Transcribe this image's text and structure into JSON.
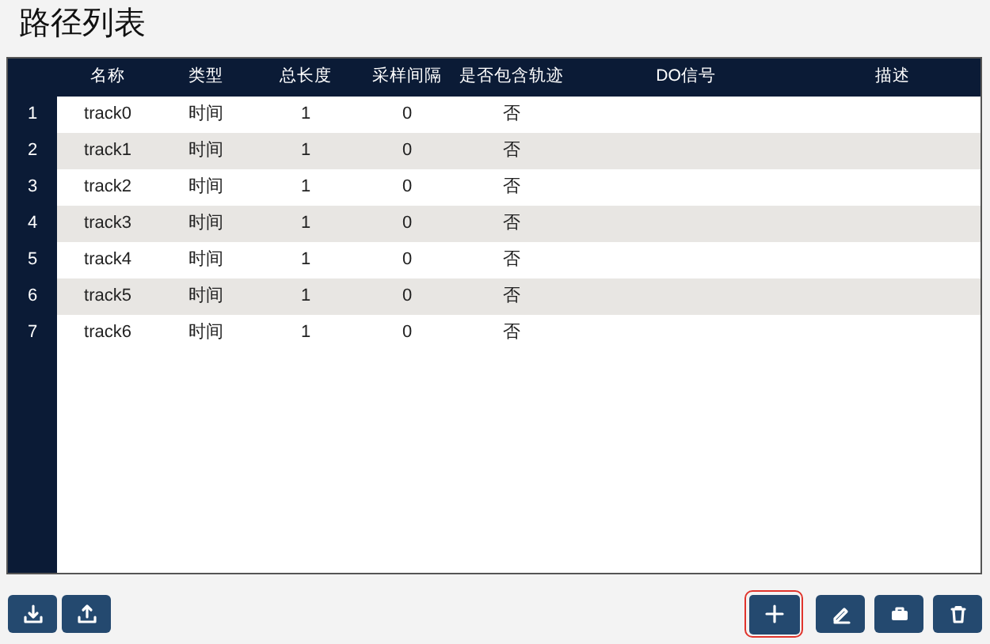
{
  "title": "路径列表",
  "table": {
    "columns": [
      "名称",
      "类型",
      "总长度",
      "采样间隔",
      "是否包含轨迹",
      "DO信号",
      "描述"
    ],
    "rows": [
      {
        "index": "1",
        "cells": [
          "track0",
          "时间",
          "1",
          "0",
          "否"
        ]
      },
      {
        "index": "2",
        "cells": [
          "track1",
          "时间",
          "1",
          "0",
          "否"
        ]
      },
      {
        "index": "3",
        "cells": [
          "track2",
          "时间",
          "1",
          "0",
          "否"
        ]
      },
      {
        "index": "4",
        "cells": [
          "track3",
          "时间",
          "1",
          "0",
          "否"
        ]
      },
      {
        "index": "5",
        "cells": [
          "track4",
          "时间",
          "1",
          "0",
          "否"
        ]
      },
      {
        "index": "6",
        "cells": [
          "track5",
          "时间",
          "1",
          "0",
          "否"
        ]
      },
      {
        "index": "7",
        "cells": [
          "track6",
          "时间",
          "1",
          "0",
          "否"
        ]
      }
    ]
  },
  "left_buttons": [
    {
      "kind": "import",
      "highlighted": false
    },
    {
      "kind": "export",
      "highlighted": false
    }
  ],
  "right_buttons": [
    {
      "kind": "add",
      "highlighted": true
    },
    {
      "kind": "edit",
      "highlighted": false
    },
    {
      "kind": "toolbox",
      "highlighted": false
    },
    {
      "kind": "delete",
      "highlighted": false
    }
  ]
}
